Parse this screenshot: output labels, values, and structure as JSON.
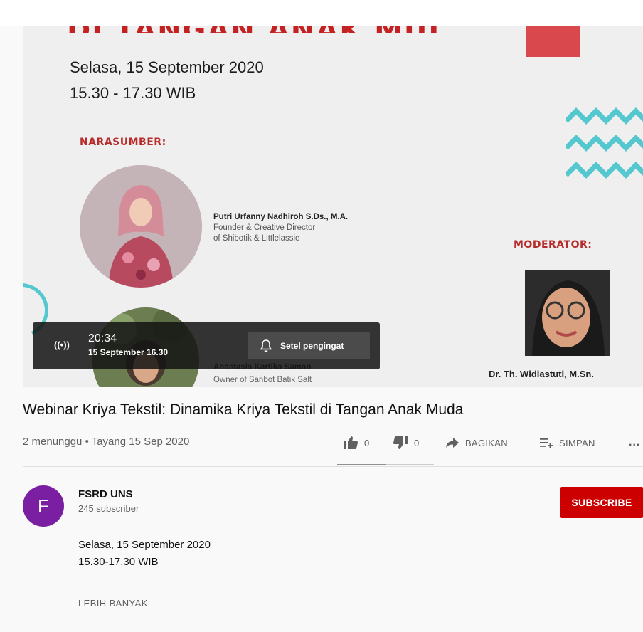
{
  "video": {
    "banner_title": "DI TANGAN ANAK MUDA",
    "event_date": "Selasa, 15 September 2020",
    "event_time": "15.30 - 17.30 WIB",
    "speakers_label": "NARASUMBER:",
    "speaker1": {
      "name": "Putri Urfanny Nadhiroh S.Ds., M.A.",
      "role_line1": "Founder & Creative Director",
      "role_line2": "of Shibotik & Littlelassie"
    },
    "speaker2": {
      "name": "Anastasia Kartika Saman",
      "role": "Owner of Sanbot Batik Salt"
    },
    "moderator_label": "MODERATOR:",
    "moderator_name": "Dr. Th. Widiastuti, M.Sn.",
    "accent_colors": {
      "red": "#d9484c",
      "teal": "#55c8cf"
    }
  },
  "live_overlay": {
    "icon": "live-broadcast-icon",
    "countdown": "20:34",
    "scheduled": "15 September 16.30",
    "reminder_label": "Setel pengingat"
  },
  "title": "Webinar Kriya Tekstil: Dinamika Kriya Tekstil di Tangan Anak Muda",
  "meta": "2 menunggu • Tayang 15 Sep 2020",
  "actions": {
    "likes": "0",
    "dislikes": "0",
    "share_label": "BAGIKAN",
    "save_label": "SIMPAN",
    "more_label": "..."
  },
  "channel": {
    "avatar_letter": "F",
    "avatar_color": "#7b1fa2",
    "name": "FSRD UNS",
    "subscribers": "245 subscriber",
    "subscribe_label": "SUBSCRIBE",
    "subscribe_color": "#cc0000"
  },
  "description": {
    "line1": "Selasa, 15 September 2020",
    "line2": "15.30-17.30 WIB",
    "show_more_label": "LEBIH BANYAK"
  }
}
